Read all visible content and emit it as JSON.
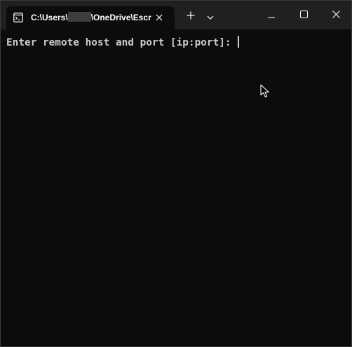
{
  "tab": {
    "title_prefix": "C:\\Users\\",
    "title_suffix": "\\OneDrive\\Escr",
    "icon": "terminal-icon",
    "close_icon": "close-icon"
  },
  "titlebar": {
    "new_tab_icon": "plus-icon",
    "dropdown_icon": "chevron-down-icon",
    "minimize_icon": "minimize-icon",
    "maximize_icon": "maximize-icon",
    "close_icon": "close-icon"
  },
  "terminal": {
    "prompt": "Enter remote host and port [ip:port]: ",
    "text_color": "#cccccc",
    "background_color": "#0c0c0c"
  },
  "colors": {
    "titlebar_bg": "#202020",
    "tab_bg": "#0c0c0c",
    "redaction": "#3e3e3e"
  }
}
